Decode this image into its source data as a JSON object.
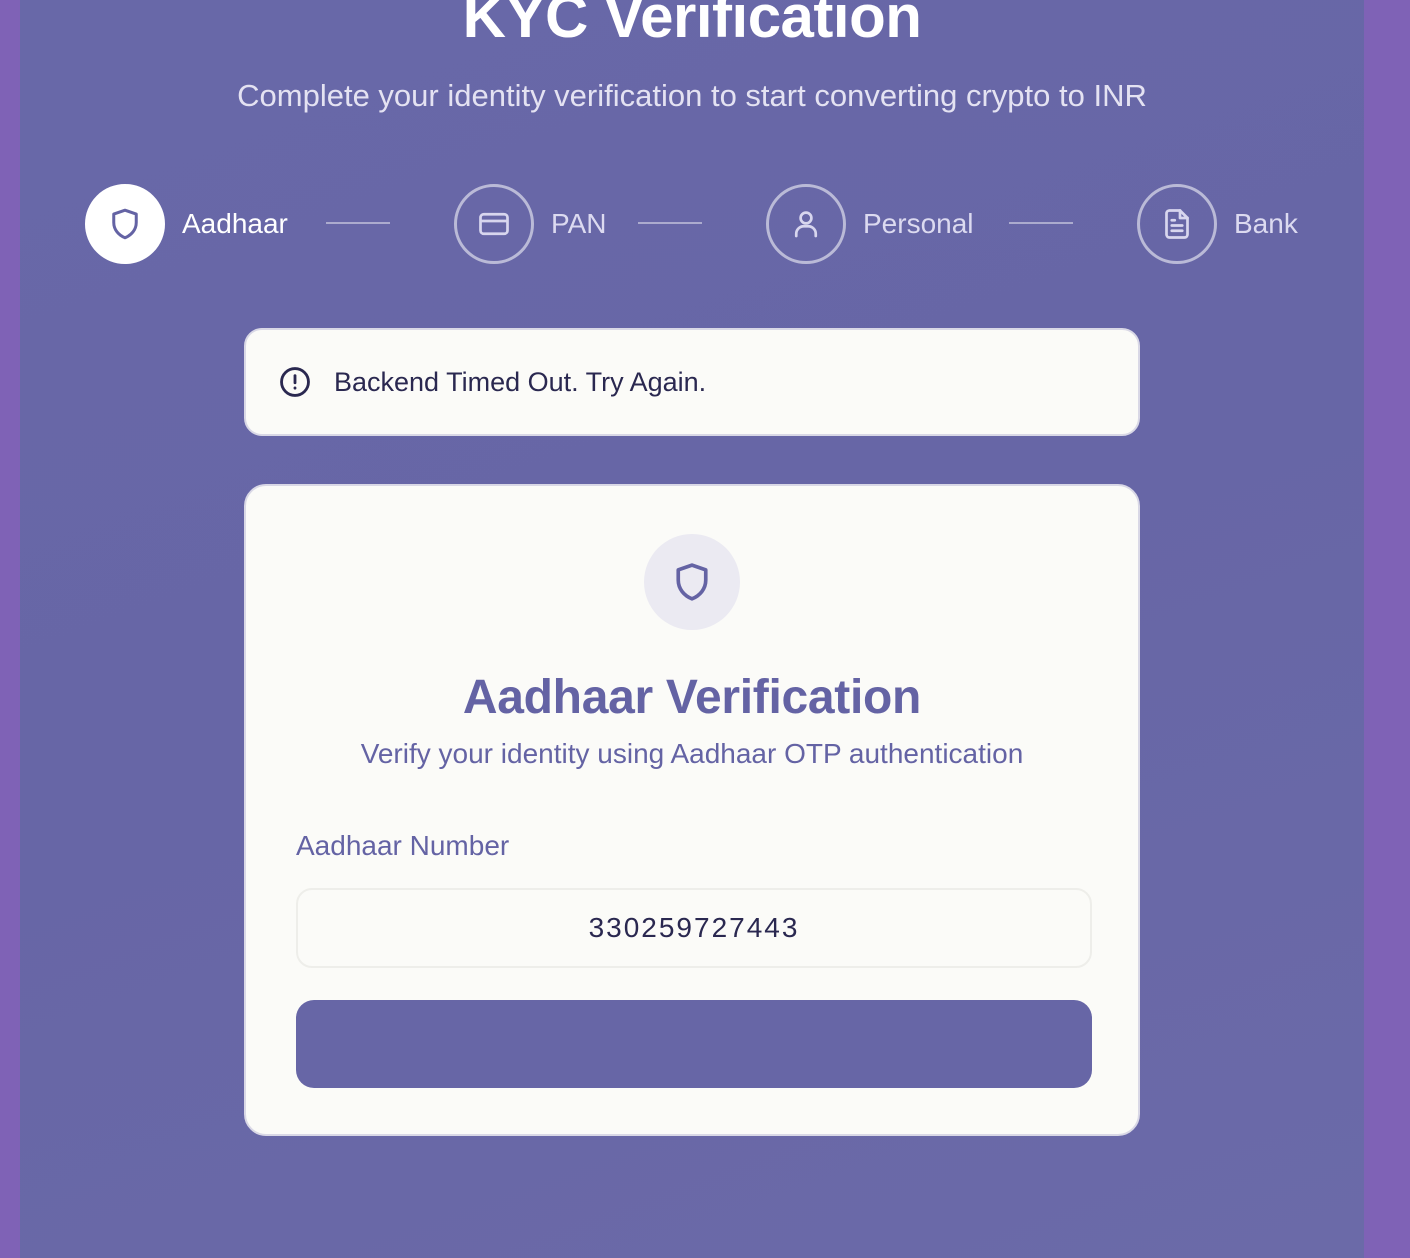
{
  "header": {
    "title": "KYC Verification",
    "subtitle": "Complete your identity verification to start converting crypto to INR"
  },
  "steps": [
    {
      "label": "Aadhaar",
      "icon": "shield-icon",
      "active": true
    },
    {
      "label": "PAN",
      "icon": "credit-card-icon",
      "active": false
    },
    {
      "label": "Personal",
      "icon": "user-icon",
      "active": false
    },
    {
      "label": "Bank",
      "icon": "document-icon",
      "active": false
    }
  ],
  "alert": {
    "icon": "alert-circle-icon",
    "message": "Backend Timed Out. Try Again."
  },
  "card": {
    "icon": "shield-icon",
    "title": "Aadhaar Verification",
    "subtitle": "Verify your identity using Aadhaar OTP authentication",
    "field_label": "Aadhaar Number",
    "field_value": "330259727443",
    "submit_label": ""
  },
  "colors": {
    "background": "#7f62b6",
    "panel": "#6766a6",
    "accent": "#6463a4",
    "card": "#fbfbf8",
    "text_dark": "#2a2850"
  }
}
